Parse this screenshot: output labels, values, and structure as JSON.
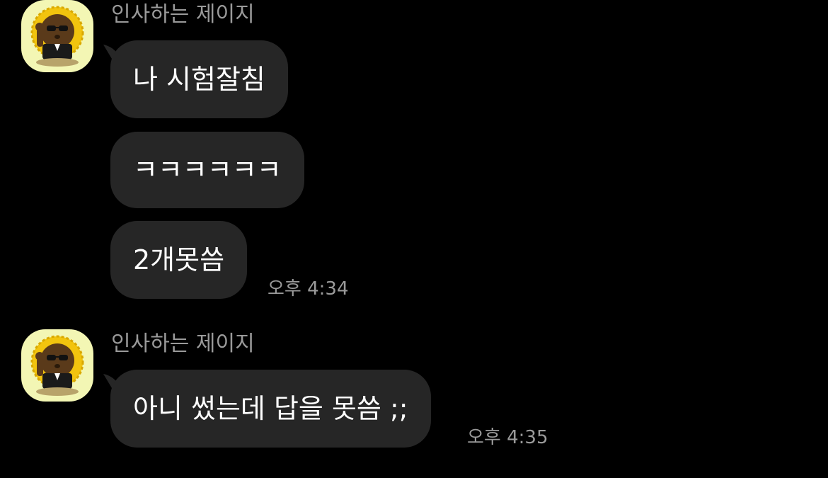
{
  "colors": {
    "background": "#000000",
    "bubble": "#262626",
    "sender_text": "#9a9a9a",
    "avatar_bg": "#f3f6b4",
    "avatar_mane": "#f2c40e"
  },
  "groups": [
    {
      "avatar_icon": "lion-character-avatar-icon",
      "sender": "인사하는 제이지",
      "messages": [
        "나 시험잘침",
        "ㅋㅋㅋㅋㅋㅋ",
        "2개못씀"
      ],
      "time": "오후 4:34"
    },
    {
      "avatar_icon": "lion-character-avatar-icon",
      "sender": "인사하는 제이지",
      "messages": [
        "아니 썼는데 답을 못씀 ;;"
      ],
      "time": "오후 4:35"
    }
  ]
}
